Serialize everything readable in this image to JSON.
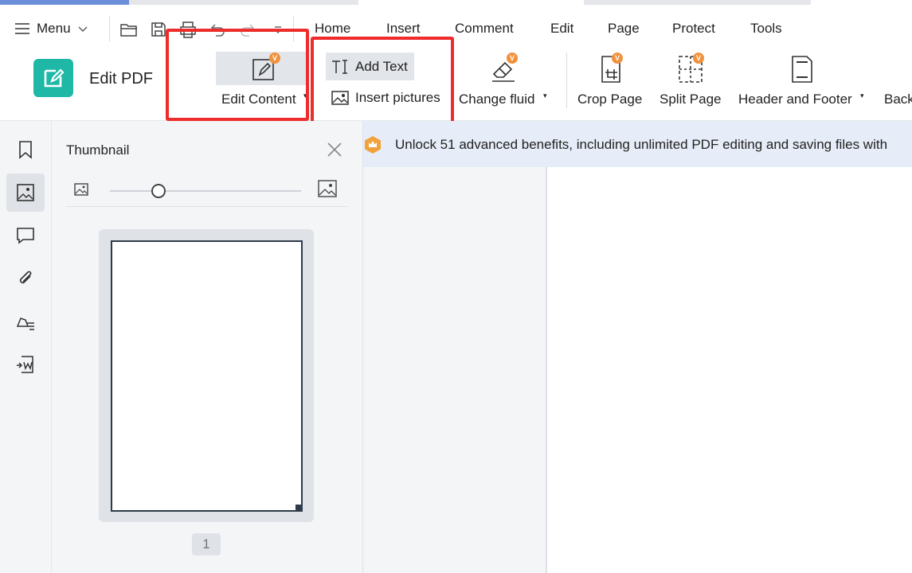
{
  "menu": {
    "label": "Menu",
    "tabs": [
      "Home",
      "Insert",
      "Comment",
      "Edit",
      "Page",
      "Protect",
      "Tools"
    ]
  },
  "ribbon": {
    "app_title": "Edit PDF",
    "edit_content": "Edit Content",
    "add_text": "Add Text",
    "insert_pictures": "Insert pictures",
    "change_fluid": "Change fluid",
    "crop_page": "Crop Page",
    "split_page": "Split Page",
    "header_footer": "Header and Footer",
    "back": "Back"
  },
  "thumbnail_panel": {
    "title": "Thumbnail",
    "page_number": "1",
    "zoom_level": 0.2
  },
  "banner": {
    "text": "Unlock 51 advanced benefits, including unlimited PDF editing and saving files with"
  },
  "colors": {
    "accent_teal": "#1fb8a6",
    "vip_badge": "#f2913d",
    "highlight_red": "#ee2c2c",
    "banner_bg": "#e6edf8"
  }
}
